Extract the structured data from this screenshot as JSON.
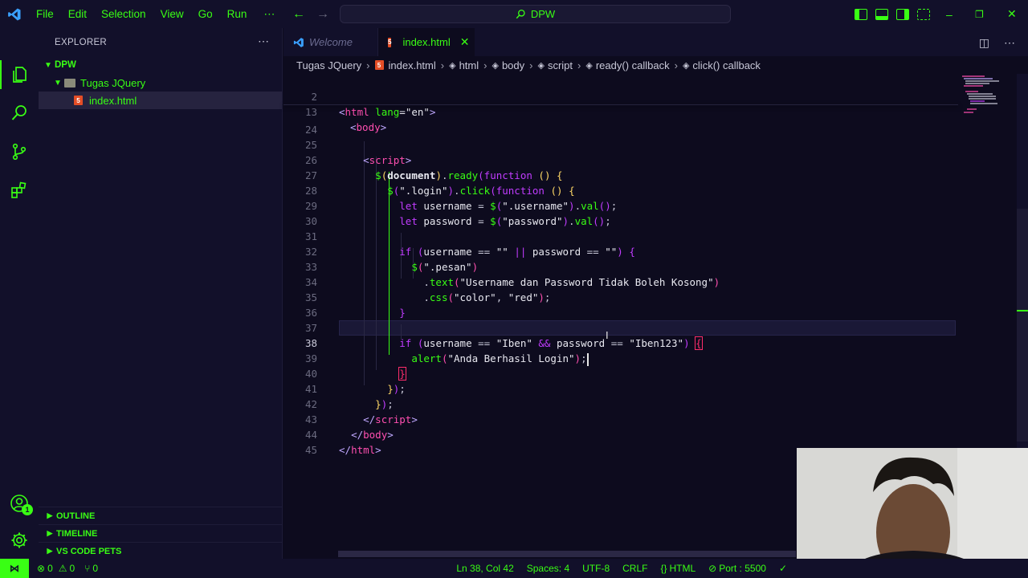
{
  "titlebar": {
    "menu": [
      "File",
      "Edit",
      "Selection",
      "View",
      "Go",
      "Run"
    ],
    "more": "⋯",
    "search_text": "DPW",
    "window_controls": [
      "–",
      "❐",
      "✕"
    ]
  },
  "sidebar": {
    "header": "EXPLORER",
    "root": "DPW",
    "folder": "Tugas JQuery",
    "file": "index.html",
    "sections": [
      "OUTLINE",
      "TIMELINE",
      "VS CODE PETS"
    ],
    "accounts_badge": "1"
  },
  "tabs": [
    {
      "label": "Welcome",
      "active": false
    },
    {
      "label": "index.html",
      "active": true
    }
  ],
  "breadcrumb": [
    "Tugas JQuery",
    "index.html",
    "html",
    "body",
    "script",
    "ready() callback",
    "click() callback"
  ],
  "editor": {
    "sticky_numbers": [
      "2",
      "13"
    ],
    "numbers": [
      "24",
      "25",
      "26",
      "27",
      "28",
      "29",
      "30",
      "31",
      "32",
      "33",
      "34",
      "35",
      "36",
      "37",
      "38",
      "39",
      "40",
      "41",
      "42",
      "43",
      "44",
      "45"
    ],
    "current_line": "38"
  },
  "status": {
    "errors": "0",
    "warnings": "0",
    "ports": "0",
    "cursor": "Ln 38, Col 42",
    "spaces": "Spaces: 4",
    "encoding": "UTF-8",
    "eol": "CRLF",
    "language": "HTML",
    "port": "Port : 5500"
  },
  "colors": {
    "accent": "#39ff14",
    "background": "#0d0b1e",
    "tag": "#ff4fb0",
    "keyword": "#c13cff"
  }
}
